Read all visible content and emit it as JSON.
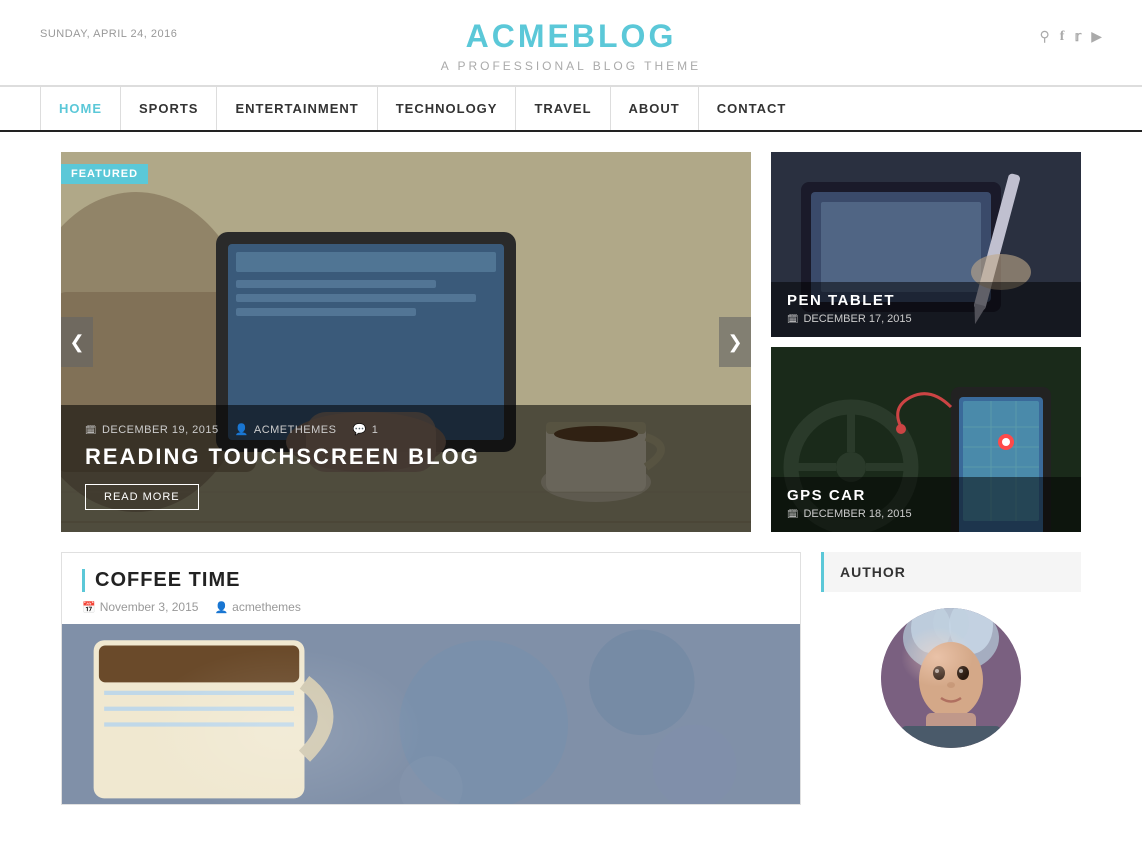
{
  "header": {
    "date": "Sunday, April 24, 2016",
    "logo": "ACMEBLOG",
    "tagline": "A Professional Blog Theme",
    "icons": [
      "search",
      "facebook",
      "twitter",
      "youtube"
    ]
  },
  "nav": {
    "items": [
      {
        "label": "HOME",
        "active": true
      },
      {
        "label": "SPORTS",
        "active": false
      },
      {
        "label": "ENTERTAINMENT",
        "active": false
      },
      {
        "label": "TECHNOLOGY",
        "active": false
      },
      {
        "label": "TRAVEL",
        "active": false
      },
      {
        "label": "ABOUT",
        "active": false
      },
      {
        "label": "CONTACT",
        "active": false
      }
    ]
  },
  "featured": {
    "badge": "FEATURED",
    "meta_date": "DECEMBER 19, 2015",
    "meta_author": "ACMETHEMES",
    "meta_comments": "1",
    "title": "READING TOUCHSCREEN BLOG",
    "read_more": "READ MORE",
    "arrow_left": "❮",
    "arrow_right": "❯"
  },
  "sidebar_cards": [
    {
      "title": "PEN TABLET",
      "date": "DECEMBER 17, 2015"
    },
    {
      "title": "GPS CAR",
      "date": "DECEMBER 18, 2015"
    }
  ],
  "blog_post": {
    "title": "COFFEE TIME",
    "date": "November 3, 2015",
    "author": "acmethemes"
  },
  "author_widget": {
    "title": "AUTHOR"
  },
  "icons": {
    "search": "🔍",
    "facebook": "f",
    "twitter": "t",
    "youtube": "▶"
  }
}
